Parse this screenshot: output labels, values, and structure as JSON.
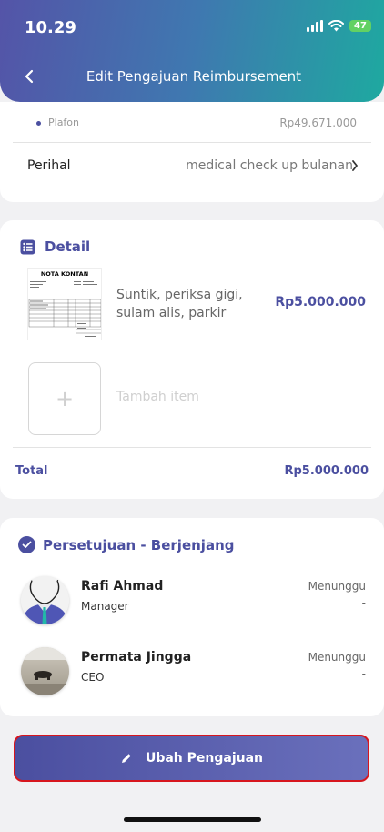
{
  "status_bar": {
    "time": "10.29",
    "battery": "47"
  },
  "header": {
    "title": "Edit  Pengajuan Reimbursement"
  },
  "summary": {
    "plafon_label": "Plafon",
    "plafon_value": "Rp49.671.000",
    "perihal_label": "Perihal",
    "perihal_value": "medical check up bulanan"
  },
  "detail": {
    "title": "Detail",
    "receipt_title": "NOTA KONTAN",
    "item": {
      "name": "Suntik, periksa gigi, sulam alis, parkir",
      "price": "Rp5.000.000"
    },
    "add_item_label": "Tambah item",
    "total_label": "Total",
    "total_value": "Rp5.000.000"
  },
  "approval": {
    "title": "Persetujuan - Berjenjang",
    "approvers": [
      {
        "name": "Rafi Ahmad",
        "role": "Manager",
        "status": "Menunggu",
        "date": "-"
      },
      {
        "name": "Permata Jingga",
        "role": "CEO",
        "status": "Menunggu",
        "date": "-"
      }
    ]
  },
  "action": {
    "label": "Ubah Pengajuan"
  },
  "colors": {
    "primary": "#4b4fa0",
    "header_start": "#5454a8",
    "header_end": "#1ea9a0",
    "highlight_border": "#d7161e"
  },
  "icons": [
    "back-arrow-icon",
    "chevron-right-icon",
    "list-icon",
    "check-circle-icon",
    "pencil-icon",
    "plus-icon"
  ]
}
